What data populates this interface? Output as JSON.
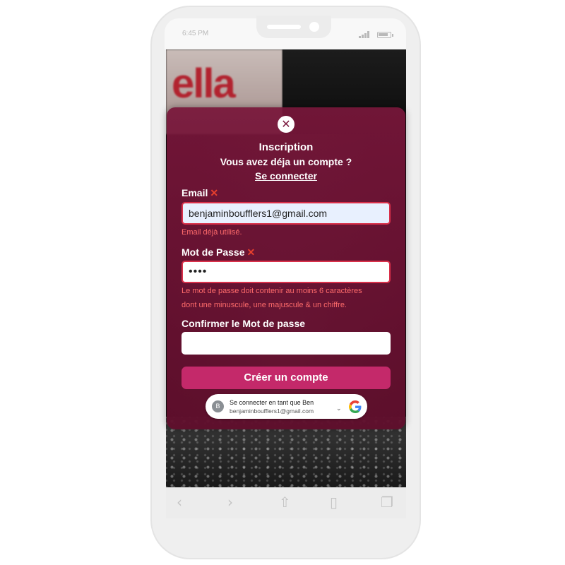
{
  "status_bar": {
    "time": "6:45 PM"
  },
  "background": {
    "sign_text": "ella"
  },
  "modal": {
    "close_glyph": "✕",
    "title": "Inscription",
    "subtitle": "Vous avez déja un compte ?",
    "login_link": "Se connecter",
    "email": {
      "label": "Email",
      "error_mark": "✕",
      "value": "benjaminboufflers1@gmail.com",
      "error": "Email déjà utilisé."
    },
    "password": {
      "label": "Mot de Passe",
      "error_mark": "✕",
      "value": "••••",
      "error_line1": "Le mot de passe doit contenir au moins 6 caractères",
      "error_line2": "dont une minuscule, une majuscule & un chiffre."
    },
    "confirm": {
      "label": "Confirmer le Mot de passe",
      "value": ""
    },
    "submit_label": "Créer un compte",
    "google": {
      "avatar_letter": "B",
      "line1": "Se connecter en tant que Ben",
      "line2": "benjaminboufflers1@gmail.com",
      "chevron": "⌄"
    }
  },
  "browser_bar": {
    "back": "‹",
    "forward": "›",
    "share": "⇧",
    "bookmarks": "▯",
    "tabs": "❐"
  },
  "colors": {
    "modal_bg": "#78163a",
    "accent_button": "#c4296a",
    "error_text": "#ff6b6b",
    "error_mark": "#e8402d"
  }
}
